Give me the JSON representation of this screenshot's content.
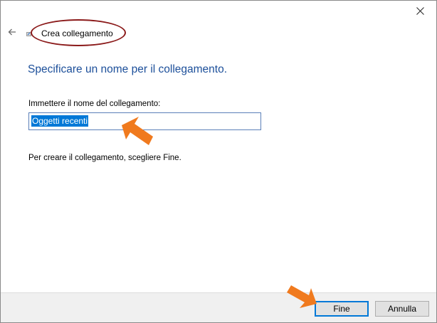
{
  "window": {
    "title": "Crea collegamento"
  },
  "content": {
    "heading": "Specificare un nome per il collegamento.",
    "field_label": "Immettere il nome del collegamento:",
    "field_value": "Oggetti recenti",
    "instruction": "Per creare il collegamento, scegliere Fine."
  },
  "footer": {
    "finish_label": "Fine",
    "cancel_label": "Annulla"
  },
  "icons": {
    "close": "close-icon",
    "back": "back-arrow-icon",
    "title": "shortcut-icon",
    "annotation": "orange-pointer-arrow-icon"
  },
  "colors": {
    "heading": "#1c4f9a",
    "selection": "#0078d7",
    "annotation_arrow": "#f07a1e",
    "annotation_ellipse": "#8b1a1a",
    "footer_bg": "#f0f0f0"
  }
}
